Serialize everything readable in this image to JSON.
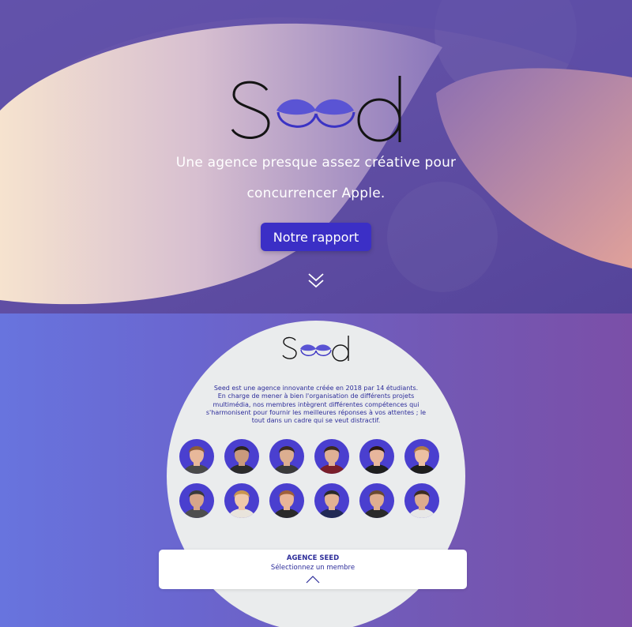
{
  "hero": {
    "logo_text": "Seed",
    "tagline_line1": "Une agence presque assez créative pour",
    "tagline_line2": "concurrencer Apple.",
    "button_label": "Notre rapport"
  },
  "about": {
    "logo_text": "Seed",
    "description": [
      "Seed est une agence innovante créée en 2018 par 14 étudiants.",
      "En charge de mener à bien l'organisation de différents projets",
      "multimédia, nos membres intègrent différentes compétences qui",
      "s'harmonisent pour fournir les meilleures réponses à vos attentes ; le",
      "tout dans un cadre qui se veut distractif."
    ],
    "members_count_label": "14 étudiants",
    "members": [
      {
        "hair": "#8a5a3a",
        "shirt": "#4a4a4a",
        "skin": "#e8b89a"
      },
      {
        "hair": "#2b2420",
        "shirt": "#2b2b2b",
        "skin": "#c99a7d"
      },
      {
        "hair": "#3a2a22",
        "shirt": "#3a3a3a",
        "skin": "#dcae90"
      },
      {
        "hair": "#3b2a20",
        "shirt": "#7a1f2a",
        "skin": "#e0b095"
      },
      {
        "hair": "#2a1812",
        "shirt": "#1f1f1f",
        "skin": "#e7b69c"
      },
      {
        "hair": "#b07a45",
        "shirt": "#1e1e1e",
        "skin": "#ecc0a2"
      },
      {
        "hair": "#3a3a3a",
        "shirt": "#4e4e4e",
        "skin": "#d7a68a"
      },
      {
        "hair": "#c9944f",
        "shirt": "#e9e4dc",
        "skin": "#f0c8aa"
      },
      {
        "hair": "#a0603a",
        "shirt": "#2a2a2a",
        "skin": "#e9b598"
      },
      {
        "hair": "#2a2a2a",
        "shirt": "#222a55",
        "skin": "#e2b294"
      },
      {
        "hair": "#6a4a30",
        "shirt": "#2a2a2a",
        "skin": "#dfae90"
      },
      {
        "hair": "#3c2c22",
        "shirt": "#e7e7e7",
        "skin": "#dcab8e"
      }
    ]
  },
  "panel": {
    "title": "AGENCE SEED",
    "subtitle": "Sélectionnez un membre"
  },
  "colors": {
    "accent": "#3b2fc6",
    "text_dark": "#2d2d9a",
    "circle_bg": "#eaeced",
    "member_bg": "#4a3fcf"
  }
}
